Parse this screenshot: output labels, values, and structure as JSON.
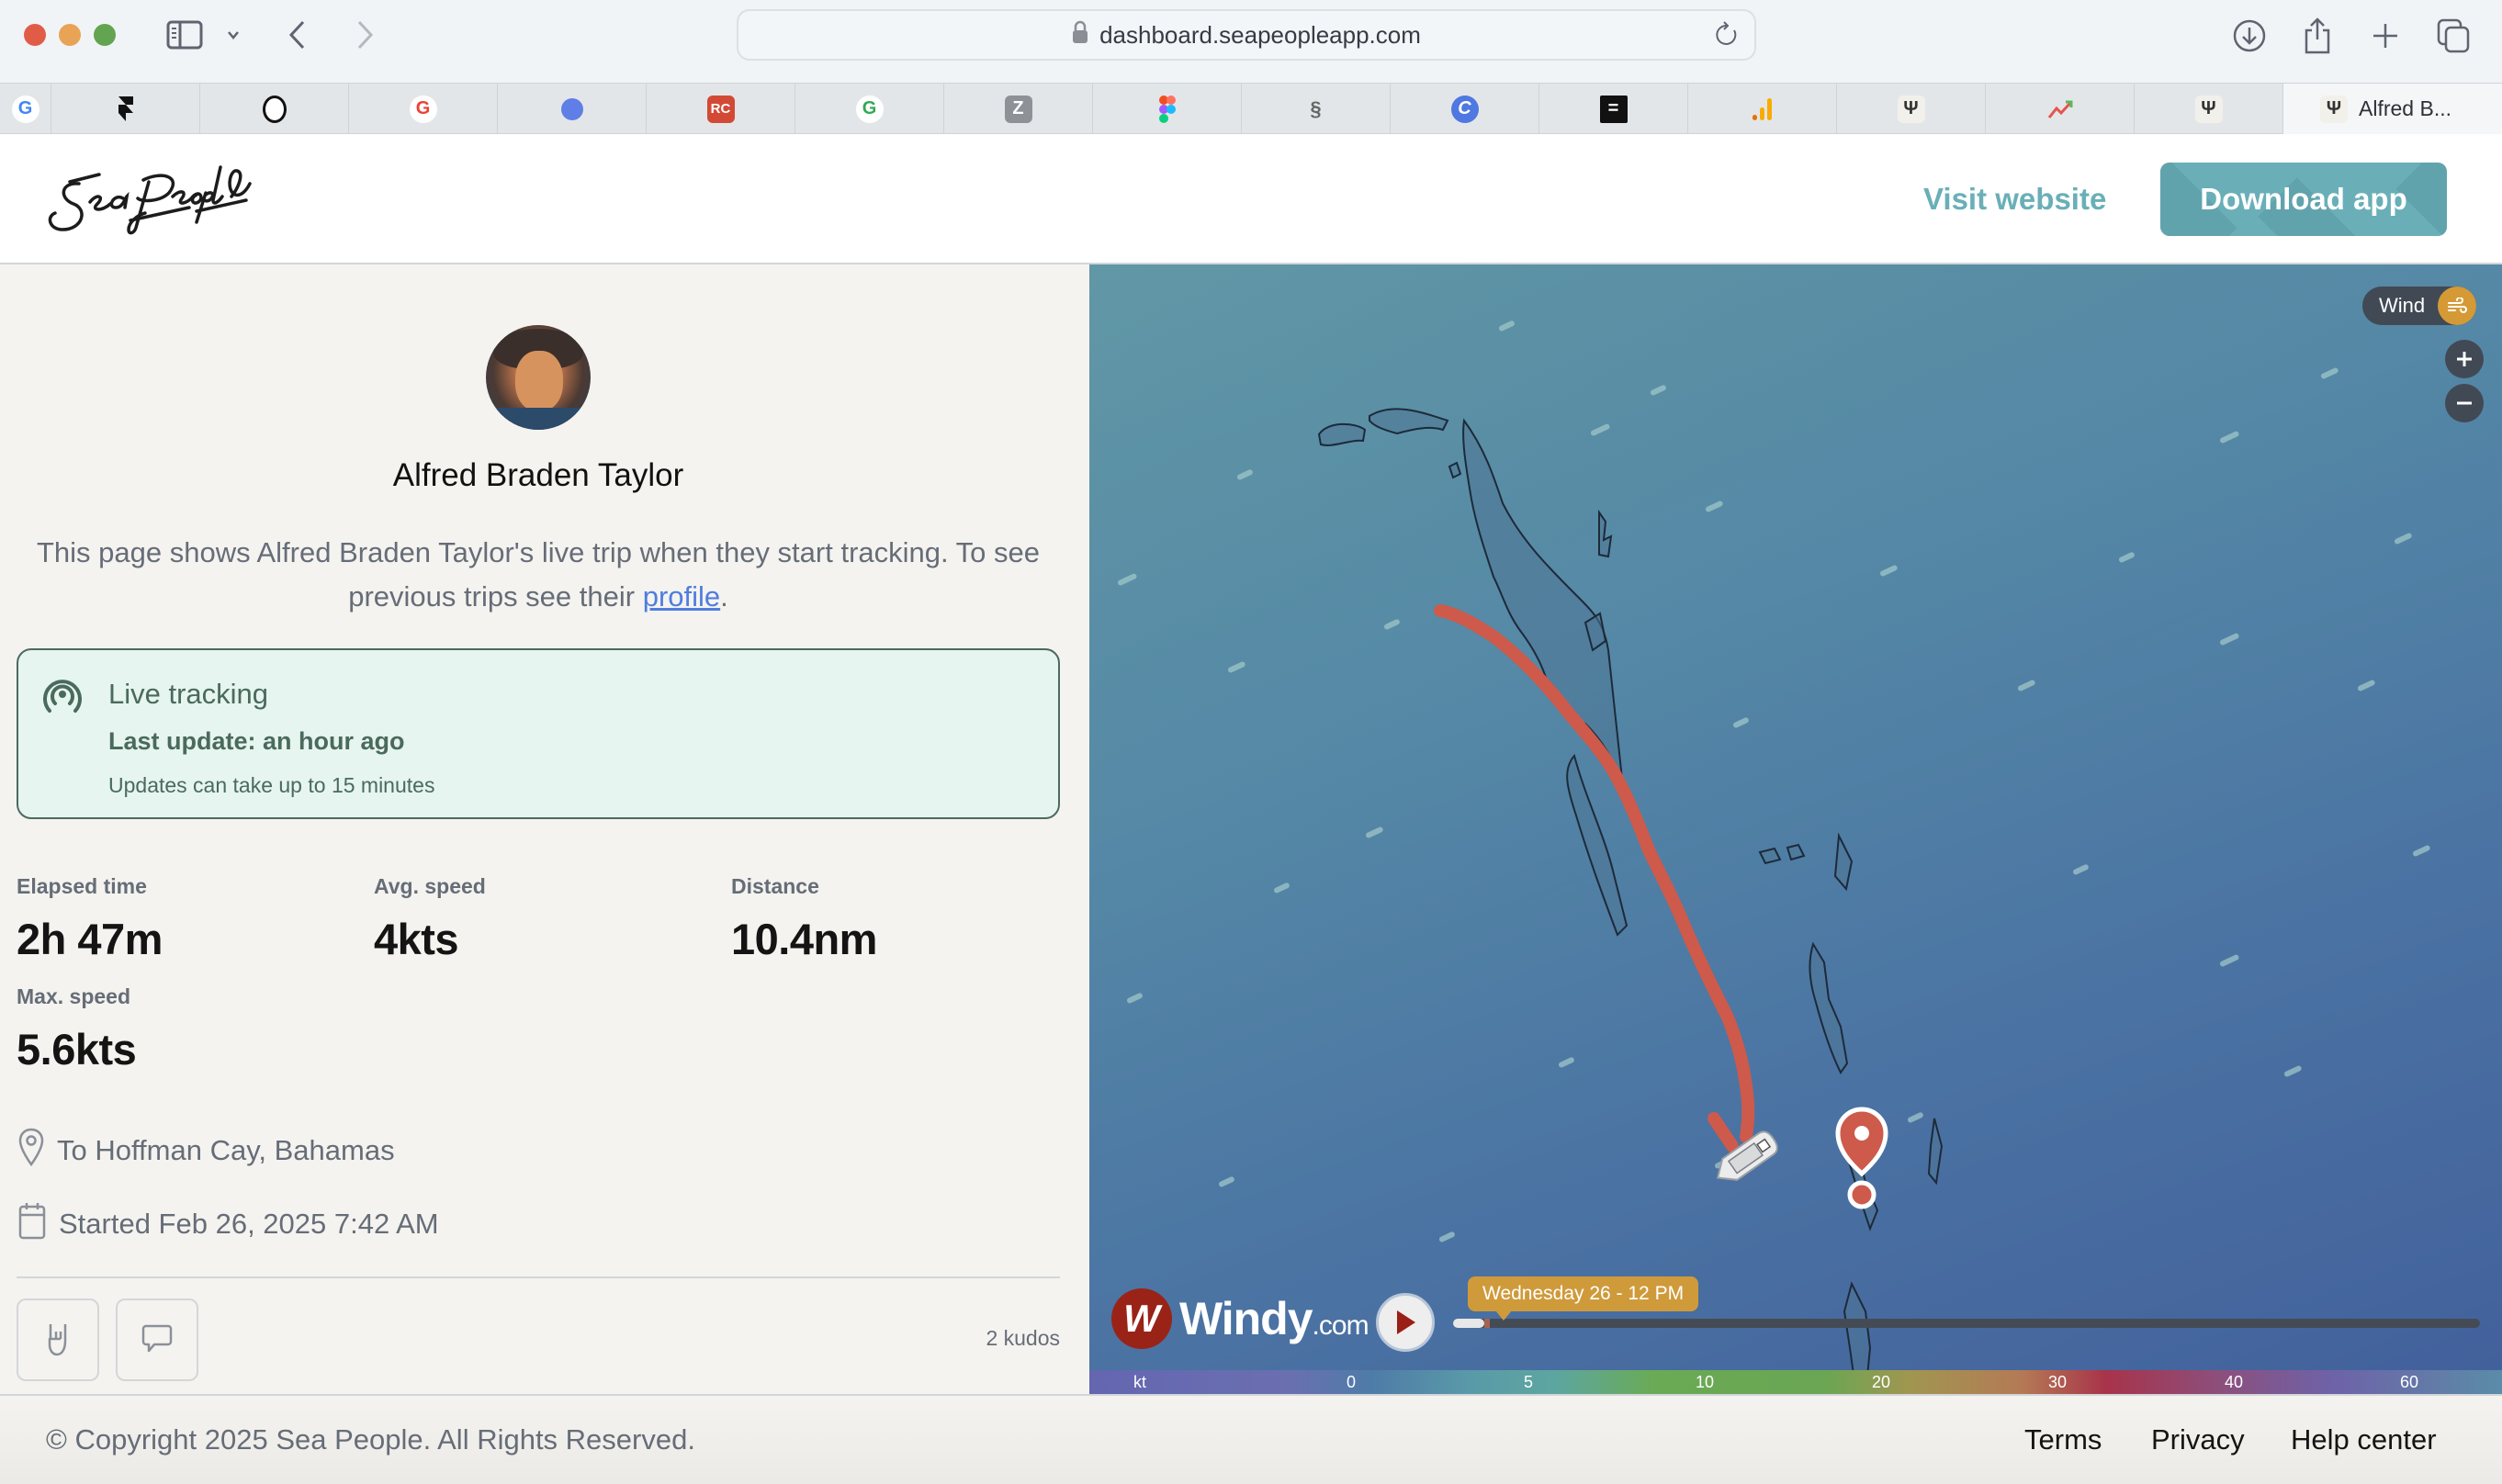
{
  "browser": {
    "url": "dashboard.seapeopleapp.com",
    "tabs": [
      {
        "icon": "google-icon"
      },
      {
        "icon": "framer-icon"
      },
      {
        "icon": "mailchimp-icon"
      },
      {
        "icon": "google-icon"
      },
      {
        "icon": "linear-icon"
      },
      {
        "icon": "rc-icon"
      },
      {
        "icon": "google-icon"
      },
      {
        "icon": "z-icon"
      },
      {
        "icon": "figma-icon"
      },
      {
        "icon": "mermaid-icon"
      },
      {
        "icon": "c-icon"
      },
      {
        "icon": "equals-icon"
      },
      {
        "icon": "analytics-icon"
      },
      {
        "icon": "trident-icon"
      },
      {
        "icon": "trend-icon"
      },
      {
        "icon": "trident-icon"
      }
    ],
    "active_tab": {
      "icon": "trident-icon",
      "title": "Alfred B..."
    }
  },
  "header": {
    "logo_text": "Sea People",
    "visit_label": "Visit website",
    "download_label": "Download app",
    "accent_color": "#6aafb8"
  },
  "profile": {
    "name": "Alfred Braden Taylor",
    "intro_text": "This page shows Alfred Braden Taylor's live trip when they start tracking. To see previous trips see their ",
    "intro_link": "profile",
    "intro_end": "."
  },
  "live": {
    "title": "Live tracking",
    "last_update": "Last update: an hour ago",
    "note": "Updates can take up to 15 minutes"
  },
  "stats": {
    "elapsed": {
      "label": "Elapsed time",
      "value": "2h 47m"
    },
    "avg_speed": {
      "label": "Avg. speed",
      "value": "4kts"
    },
    "distance": {
      "label": "Distance",
      "value": "10.4nm"
    },
    "max_speed": {
      "label": "Max. speed",
      "value": "5.6kts"
    }
  },
  "trip": {
    "destination": "To Hoffman Cay, Bahamas",
    "started": "Started Feb 26, 2025 7:42 AM",
    "kudos": "2 kudos"
  },
  "map": {
    "layer_label": "Wind",
    "windy_brand": "Windy",
    "windy_suffix": ".com",
    "time_label": "Wednesday 26 - 12 PM",
    "timeline_progress": 0.03,
    "legend_unit": "kt",
    "legend_ticks": [
      "0",
      "5",
      "10",
      "20",
      "30",
      "40",
      "60"
    ],
    "track_color": "#cd5a4b"
  },
  "footer": {
    "copyright": "© Copyright 2025 Sea People. All Rights Reserved.",
    "links": [
      "Terms",
      "Privacy",
      "Help center"
    ]
  }
}
